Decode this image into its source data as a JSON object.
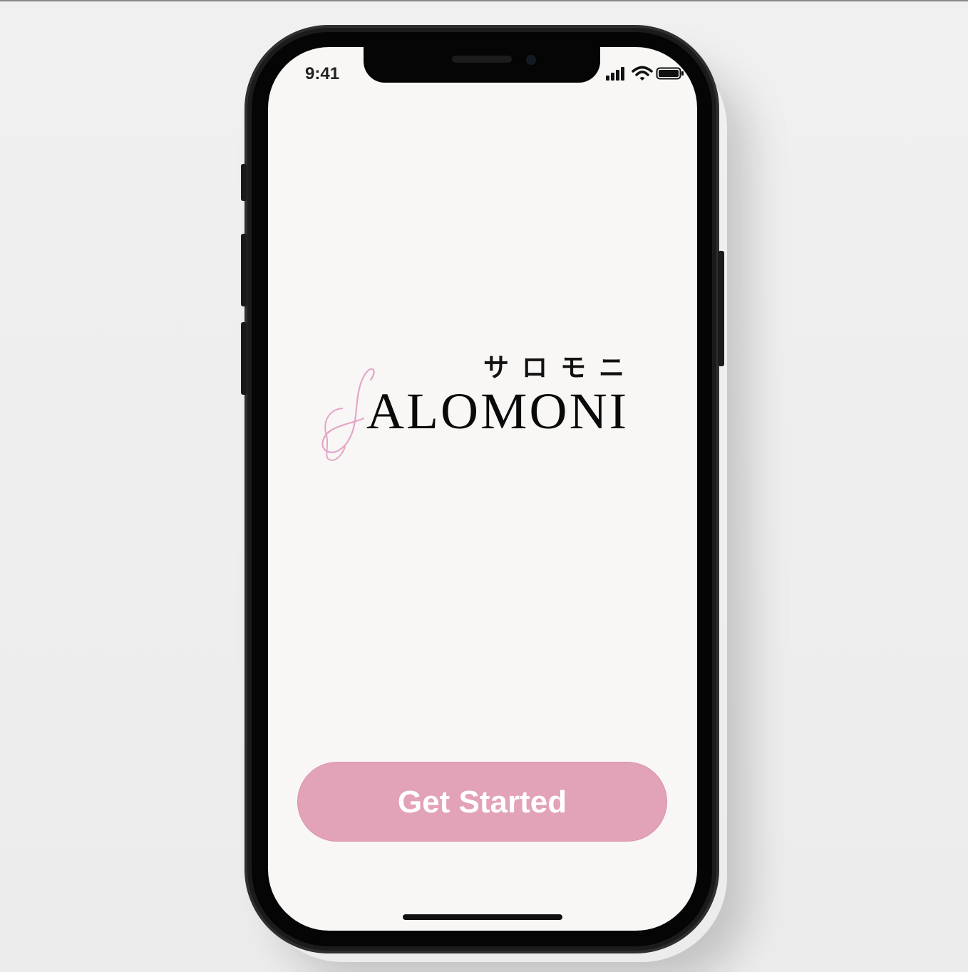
{
  "status_bar": {
    "time": "9:41",
    "icons": [
      "signal-icon",
      "wifi-icon",
      "battery-icon"
    ]
  },
  "logo": {
    "katakana": "サロモニ",
    "wordmark": "ALOMONI",
    "swash_letter": "S",
    "swash_color": "#e4a6c8"
  },
  "cta": {
    "label": "Get Started",
    "color": "#e2a2b8"
  }
}
